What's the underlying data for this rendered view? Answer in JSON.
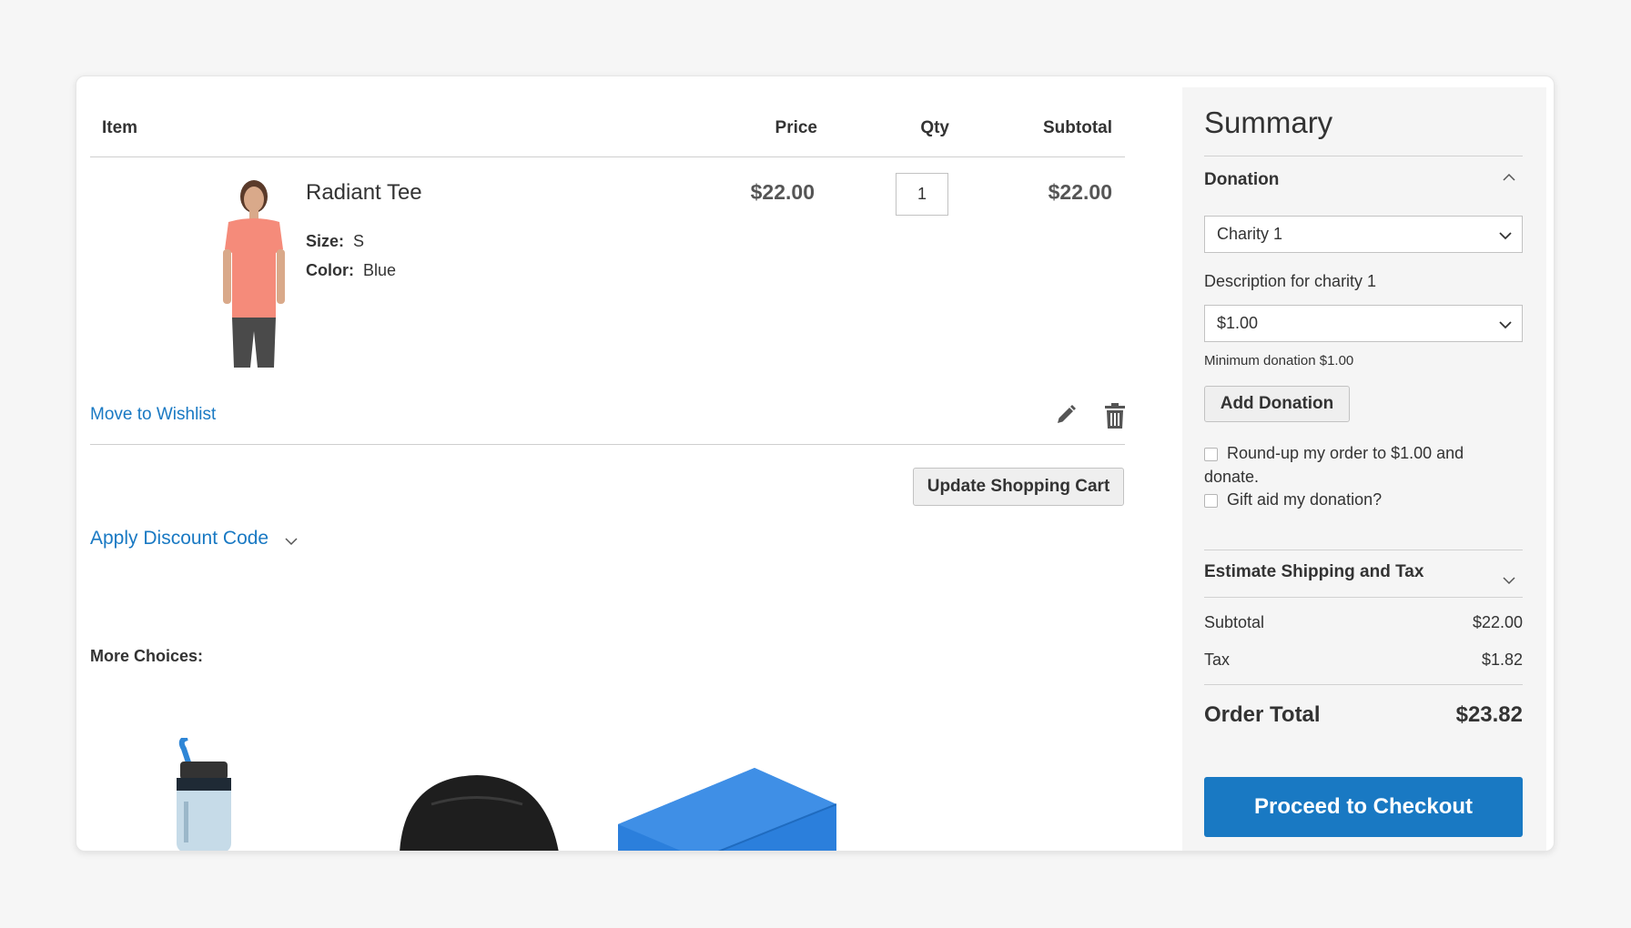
{
  "cart": {
    "headers": {
      "item": "Item",
      "price": "Price",
      "qty": "Qty",
      "subtotal": "Subtotal"
    },
    "item": {
      "name": "Radiant Tee",
      "size_label": "Size:",
      "size": "S",
      "color_label": "Color:",
      "color": "Blue",
      "price": "$22.00",
      "qty": "1",
      "subtotal": "$22.00",
      "move_to_wishlist": "Move to Wishlist"
    },
    "update_button": "Update Shopping Cart",
    "discount_label": "Apply Discount Code",
    "more_choices": "More Choices:"
  },
  "summary": {
    "title": "Summary",
    "donation": {
      "label": "Donation",
      "charity_selected": "Charity 1",
      "description": "Description for charity 1",
      "amount_selected": "$1.00",
      "minimum": "Minimum donation $1.00",
      "add_button": "Add Donation",
      "roundup": "Round-up my order to $1.00 and donate.",
      "gift_aid": "Gift aid my donation?"
    },
    "shipping_label": "Estimate Shipping and Tax",
    "subtotal_label": "Subtotal",
    "subtotal_value": "$22.00",
    "tax_label": "Tax",
    "tax_value": "$1.82",
    "order_total_label": "Order Total",
    "order_total_value": "$23.82",
    "checkout_button": "Proceed to Checkout"
  },
  "colors": {
    "accent": "#1979c3",
    "link": "#1979c3",
    "summary_bg": "#f5f5f5"
  },
  "icons": [
    "pencil-icon",
    "trash-icon",
    "chevron-down-icon",
    "chevron-up-icon"
  ]
}
